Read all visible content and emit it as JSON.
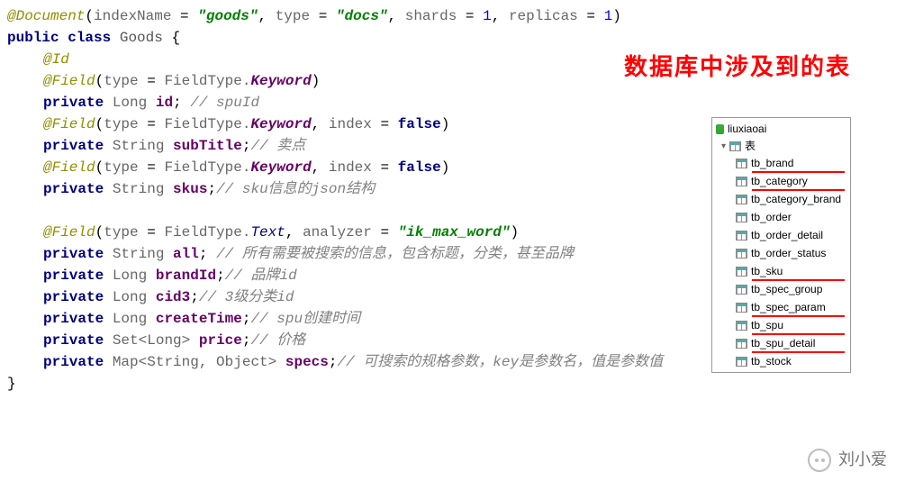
{
  "code": {
    "ann_document": "@Document",
    "doc_params": {
      "indexName_key": "indexName",
      "indexName_val": "\"goods\"",
      "type_key": "type",
      "type_val": "\"docs\"",
      "shards_key": "shards",
      "shards_val": "1",
      "replicas_key": "replicas",
      "replicas_val": "1"
    },
    "kw_public": "public",
    "kw_class": "class",
    "class_name": "Goods",
    "ann_id": "@Id",
    "ann_field": "@Field",
    "field_type_label": "type",
    "field_type_prefix": "FieldType.",
    "ft_keyword": "Keyword",
    "ft_text": "Text",
    "index_key": "index",
    "index_val": "false",
    "analyzer_key": "analyzer",
    "analyzer_val": "\"ik_max_word\"",
    "kw_private": "private",
    "t_long": "Long",
    "t_string": "String",
    "t_set": "Set<Long>",
    "t_map": "Map<String, Object>",
    "v_id": "id",
    "c_id": "// spuId",
    "v_subTitle": "subTitle",
    "c_subTitle": "// 卖点",
    "v_skus": "skus",
    "c_skus": "// sku信息的json结构",
    "v_all": "all",
    "c_all": "// 所有需要被搜索的信息，包含标题，分类，甚至品牌",
    "v_brandId": "brandId",
    "c_brandId": "// 品牌id",
    "v_cid3": "cid3",
    "c_cid3": "// 3级分类id",
    "v_createTime": "createTime",
    "c_createTime": "// spu创建时间",
    "v_price": "price",
    "c_price": "// 价格",
    "v_specs": "specs",
    "c_specs": "// 可搜索的规格参数，key是参数名，值是参数值"
  },
  "red_title": "数据库中涉及到的表",
  "db": {
    "name": "liuxiaoai",
    "folder": "表",
    "tables": [
      {
        "name": "tb_brand",
        "hl": true
      },
      {
        "name": "tb_category",
        "hl": true
      },
      {
        "name": "tb_category_brand",
        "hl": false
      },
      {
        "name": "tb_order",
        "hl": false
      },
      {
        "name": "tb_order_detail",
        "hl": false
      },
      {
        "name": "tb_order_status",
        "hl": false
      },
      {
        "name": "tb_sku",
        "hl": true
      },
      {
        "name": "tb_spec_group",
        "hl": false
      },
      {
        "name": "tb_spec_param",
        "hl": true
      },
      {
        "name": "tb_spu",
        "hl": true
      },
      {
        "name": "tb_spu_detail",
        "hl": true
      },
      {
        "name": "tb_stock",
        "hl": false
      }
    ]
  },
  "watermark": "刘小爱"
}
